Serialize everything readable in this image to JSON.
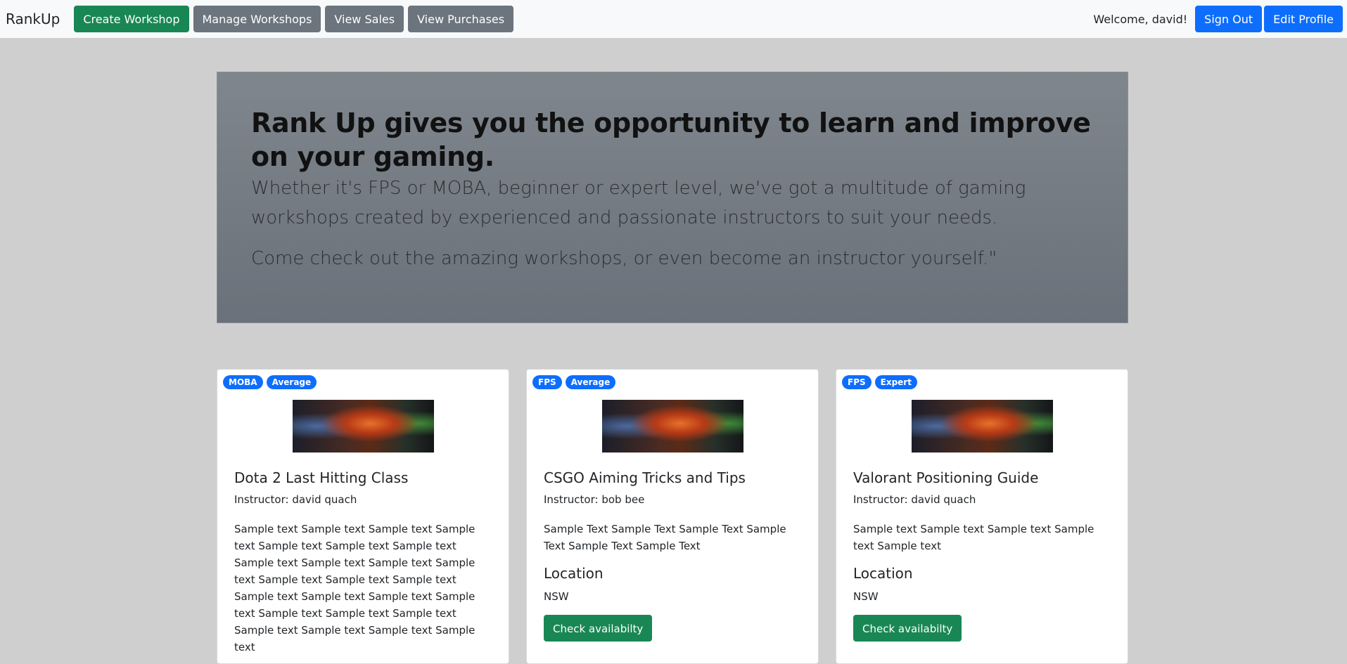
{
  "navbar": {
    "brand": "RankUp",
    "buttons": [
      {
        "label": "Create Workshop"
      },
      {
        "label": "Manage Workshops"
      },
      {
        "label": "View Sales"
      },
      {
        "label": "View Purchases"
      }
    ],
    "welcome": "Welcome, david!",
    "sign_out": "Sign Out",
    "edit_profile": "Edit Profile"
  },
  "hero": {
    "heading": "Rank Up gives you the opportunity to learn and improve on your gaming.",
    "lead": "Whether it's FPS or MOBA, beginner or expert level, we've got a multitude of gaming workshops created by experienced and passionate instructors to suit your needs.",
    "lead2": "Come check out the amazing workshops, or even become an instructor yourself.\""
  },
  "cards": [
    {
      "badges": [
        "MOBA",
        "Average"
      ],
      "title": "Dota 2 Last Hitting Class",
      "instructor": "Instructor: david quach",
      "description": "Sample text Sample text Sample text Sample text Sample text Sample text Sample text Sample text Sample text Sample text Sample text Sample text Sample text Sample text Sample text Sample text Sample text Sample text Sample text Sample text Sample text Sample text Sample text Sample text Sample text"
    },
    {
      "badges": [
        "FPS",
        "Average"
      ],
      "title": "CSGO Aiming Tricks and Tips",
      "instructor": "Instructor: bob bee",
      "description": "Sample Text Sample Text Sample Text Sample Text Sample Text Sample Text",
      "location_heading": "Location",
      "location": "NSW",
      "button": "Check availabilty"
    },
    {
      "badges": [
        "FPS",
        "Expert"
      ],
      "title": "Valorant Positioning Guide",
      "instructor": "Instructor: david quach",
      "description": "Sample text Sample text Sample text Sample text Sample text",
      "location_heading": "Location",
      "location": "NSW",
      "button": "Check availabilty"
    }
  ],
  "colors": {
    "primary": "#0d6efd",
    "success": "#198754",
    "secondary": "#6c757d",
    "page_background": "#cfcfcf"
  }
}
